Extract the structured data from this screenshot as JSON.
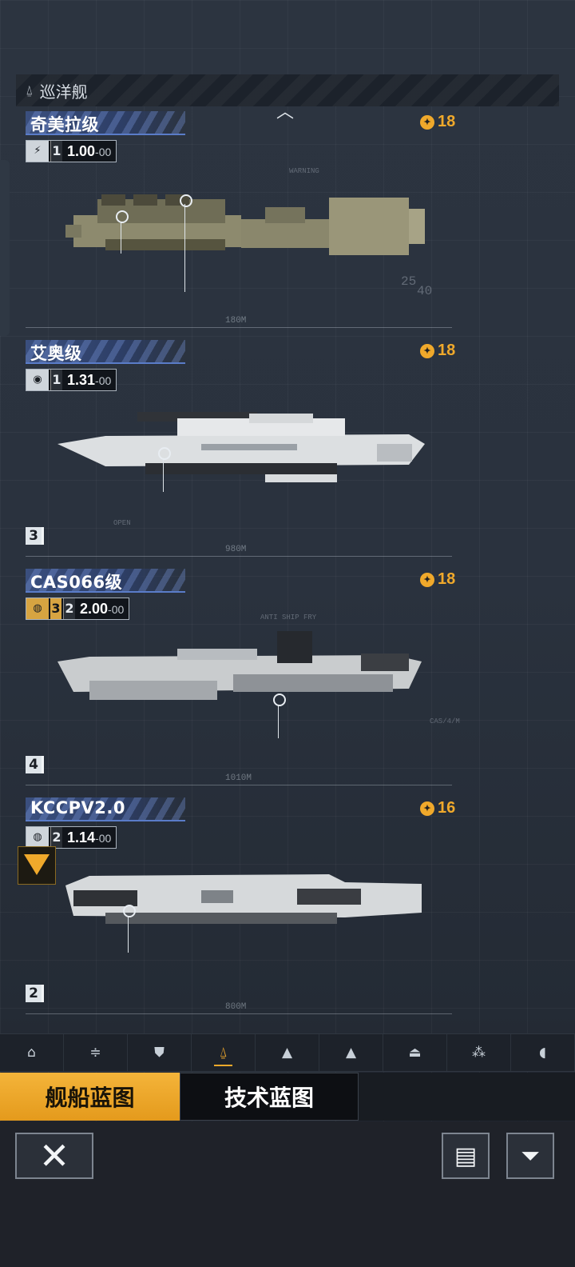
{
  "category": {
    "icon": "cruiser-class-icon",
    "label": "巡洋舰"
  },
  "ships": [
    {
      "name": "奇美拉级",
      "cost": "18",
      "type_icon": "type-icon",
      "tier_a": "1",
      "tier_b": "",
      "value_main": "1.00",
      "value_sub": "-00",
      "scale": "180M",
      "count": ""
    },
    {
      "name": "艾奥级",
      "cost": "18",
      "type_icon": "type-icon",
      "tier_a": "1",
      "tier_b": "",
      "value_main": "1.31",
      "value_sub": "-00",
      "scale": "980M",
      "count": "3"
    },
    {
      "name": "CAS066级",
      "cost": "18",
      "type_icon": "globe-icon",
      "tier_a": "3",
      "tier_b": "2",
      "value_main": "2.00",
      "value_sub": "-00",
      "scale": "1010M",
      "count": "4"
    },
    {
      "name": "KCCPV2.0",
      "cost": "16",
      "type_icon": "globe-icon",
      "tier_a": "2",
      "tier_b": "",
      "value_main": "1.14",
      "value_sub": "-00",
      "scale": "800M",
      "count": "2"
    }
  ],
  "ship_classes": [
    {
      "id": "frigate",
      "icon": "frigate-icon",
      "glyph": "⌂"
    },
    {
      "id": "destroyer",
      "icon": "destroyer-icon",
      "glyph": "≑"
    },
    {
      "id": "escort",
      "icon": "escort-icon",
      "glyph": "⛊"
    },
    {
      "id": "cruiser",
      "icon": "cruiser-icon",
      "glyph": "⍙",
      "active": true
    },
    {
      "id": "battlecruiser",
      "icon": "battlecruiser-icon",
      "glyph": "▲"
    },
    {
      "id": "battleship",
      "icon": "battleship-icon",
      "glyph": "▲"
    },
    {
      "id": "carrier",
      "icon": "carrier-icon",
      "glyph": "⏏"
    },
    {
      "id": "aux",
      "icon": "auxiliary-icon",
      "glyph": "⁂"
    },
    {
      "id": "dome",
      "icon": "dome-icon",
      "glyph": "◖"
    }
  ],
  "tabs": {
    "ship_blueprint": "舰船蓝图",
    "tech_blueprint": "技术蓝图"
  },
  "buttons": {
    "close": "close-icon",
    "doc": "document-icon",
    "filter": "filter-icon"
  },
  "deco": {
    "warning": "WARNING",
    "open": "OPEN",
    "antiship": "ANTI SHIP FRY",
    "cas_label": "CAS/4/M",
    "numbers_25": "25",
    "numbers_40": "40"
  },
  "colors": {
    "accent": "#f0a92b",
    "name_bar": "#3a4f7e",
    "bg": "#2a323e"
  }
}
